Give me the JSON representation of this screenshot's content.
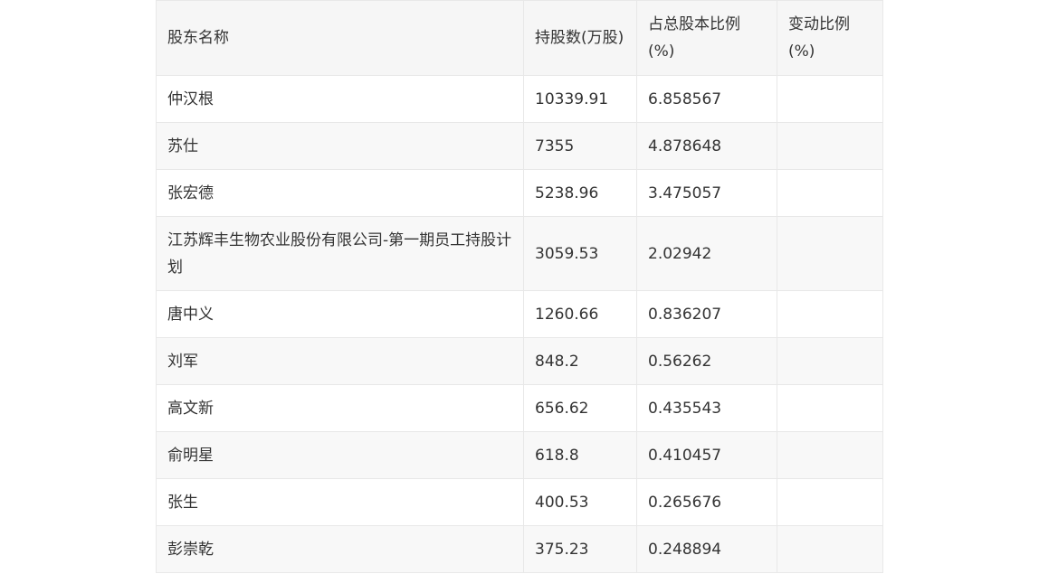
{
  "table": {
    "headers": {
      "name": "股东名称",
      "shares": "持股数(万股)",
      "pct": "占总股本比例(%)",
      "change": "变动比例(%)"
    },
    "rows": [
      {
        "name": "仲汉根",
        "shares": "10339.91",
        "pct": "6.858567",
        "change": ""
      },
      {
        "name": "苏仕",
        "shares": "7355",
        "pct": "4.878648",
        "change": ""
      },
      {
        "name": "张宏德",
        "shares": "5238.96",
        "pct": "3.475057",
        "change": ""
      },
      {
        "name": "江苏辉丰生物农业股份有限公司-第一期员工持股计划",
        "shares": "3059.53",
        "pct": "2.02942",
        "change": ""
      },
      {
        "name": "唐中义",
        "shares": "1260.66",
        "pct": "0.836207",
        "change": ""
      },
      {
        "name": "刘军",
        "shares": "848.2",
        "pct": "0.56262",
        "change": ""
      },
      {
        "name": "高文新",
        "shares": "656.62",
        "pct": "0.435543",
        "change": ""
      },
      {
        "name": "俞明星",
        "shares": "618.8",
        "pct": "0.410457",
        "change": ""
      },
      {
        "name": "张生",
        "shares": "400.53",
        "pct": "0.265676",
        "change": ""
      },
      {
        "name": "彭崇乾",
        "shares": "375.23",
        "pct": "0.248894",
        "change": ""
      }
    ]
  }
}
